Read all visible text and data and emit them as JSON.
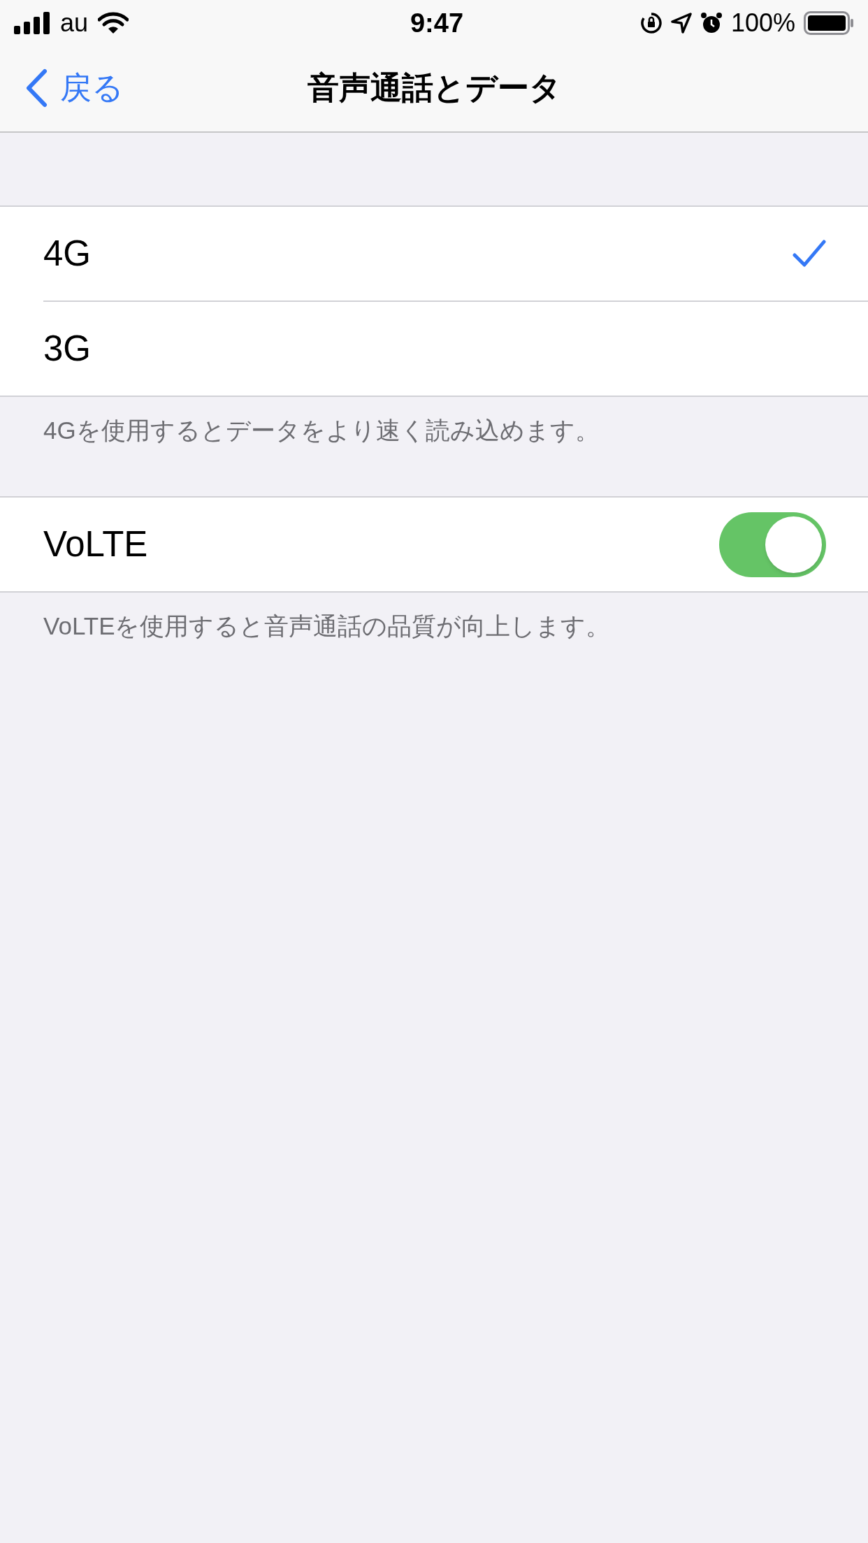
{
  "status_bar": {
    "carrier": "au",
    "time": "9:47",
    "battery": "100%"
  },
  "nav": {
    "back": "戻る",
    "title": "音声通話とデータ"
  },
  "sections": [
    {
      "rows": [
        {
          "kind": "choice",
          "label": "4G",
          "selected": true
        },
        {
          "kind": "choice",
          "label": "3G",
          "selected": false
        }
      ],
      "footer": "4Gを使用するとデータをより速く読み込めます。"
    },
    {
      "rows": [
        {
          "kind": "toggle",
          "label": "VoLTE",
          "on": true
        }
      ],
      "footer": "VoLTEを使用すると音声通話の品質が向上します。"
    }
  ]
}
